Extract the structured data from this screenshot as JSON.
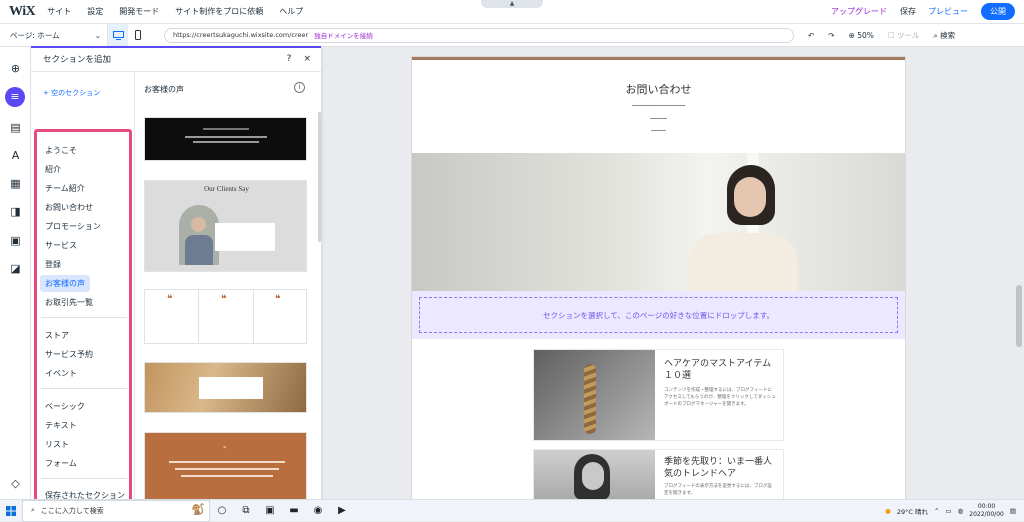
{
  "topbar": {
    "logo": "WiX",
    "menu": [
      "サイト",
      "設定",
      "開発モード",
      "サイト制作をプロに依頼",
      "ヘルプ"
    ],
    "upgrade": "アップグレード",
    "save": "保存",
    "preview": "プレビュー",
    "publish": "公開"
  },
  "secondbar": {
    "page": "ページ: ホーム",
    "url": "https://creertsukaguchi.wixsite.com/creer",
    "connect_domain": "独自ドメインを接続",
    "zoom": "50%",
    "tools": "ツール",
    "search": "検索"
  },
  "panel": {
    "title": "セクションを追加",
    "help": "?",
    "close": "×",
    "my_sections": "+ 空のセクション",
    "categories_group1": [
      "ようこそ",
      "紹介",
      "チーム紹介",
      "お問い合わせ",
      "プロモーション",
      "サービス",
      "登録",
      "お客様の声",
      "お取引先一覧"
    ],
    "categories_group2": [
      "ストア",
      "サービス予約",
      "イベント"
    ],
    "categories_group3": [
      "ベーシック",
      "テキスト",
      "リスト",
      "フォーム"
    ],
    "saved": "保存されたセクション",
    "selected_category": "お客様の声",
    "content_title": "お客様の声",
    "thumb2_title": "Our Clients Say"
  },
  "canvas": {
    "contact_title": "お問い合わせ",
    "drop_text": "セクションを選択して、このページの好きな位置にドロップします。",
    "cards": [
      {
        "title": "ヘアケアのマストアイテム１０選",
        "desc": "コンテンツを作成・整理するには、ブログフィードにアクセスしてもらうのが、整理をクリックしてダッシュボードのブログマネージャーを開きます。"
      },
      {
        "title": "季節を先取り：いま一番人気のトレンドヘア",
        "desc": "ブログフィードの表示方法を変更するには、ブログ設定を開きます。"
      }
    ]
  },
  "taskbar": {
    "search_placeholder": "ここに入力して検索",
    "weather": "29°C 晴れ",
    "time": "00:00",
    "date": "2022/00/00"
  },
  "colors": {
    "accent": "#116dff",
    "upgrade": "#9a27d5",
    "highlight": "#e84a7f",
    "drop_zone": "#ece8ff"
  }
}
